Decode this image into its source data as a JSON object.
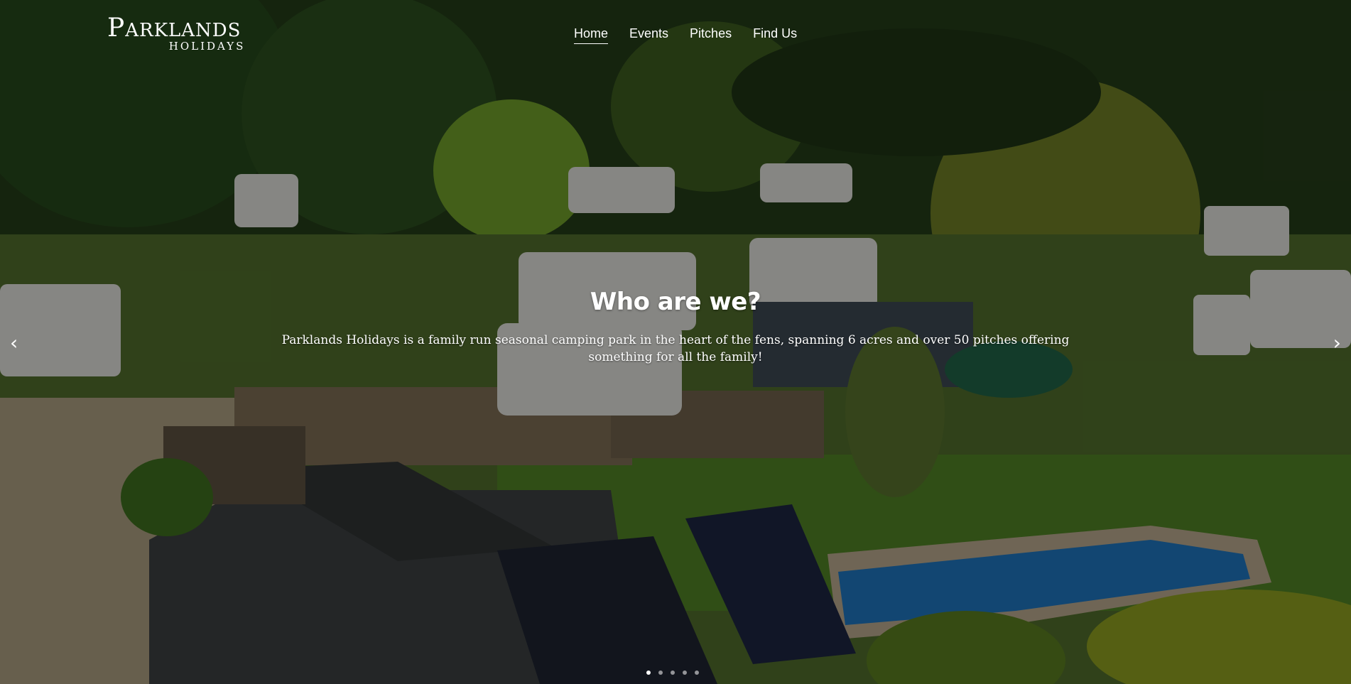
{
  "brand": {
    "name_first": "P",
    "name_rest": "ARKLANDS",
    "subtitle": "HOLIDAYS"
  },
  "nav": [
    {
      "label": "Home",
      "active": true
    },
    {
      "label": "Events",
      "active": false
    },
    {
      "label": "Pitches",
      "active": false
    },
    {
      "label": "Find Us",
      "active": false
    }
  ],
  "slide": {
    "title": "Who are we?",
    "text": "Parklands Holidays is a family run seasonal camping park in the heart of the fens, spanning 6 acres and over 50 pitches offering something for all the family!"
  },
  "carousel": {
    "prev_icon": "‹",
    "next_icon": "›",
    "slide_count": 5,
    "active_index": 0
  },
  "colors": {
    "overlay": "#000000",
    "text": "#ffffff",
    "pool": "#1f6fae",
    "grass": "#3d6b1d"
  }
}
